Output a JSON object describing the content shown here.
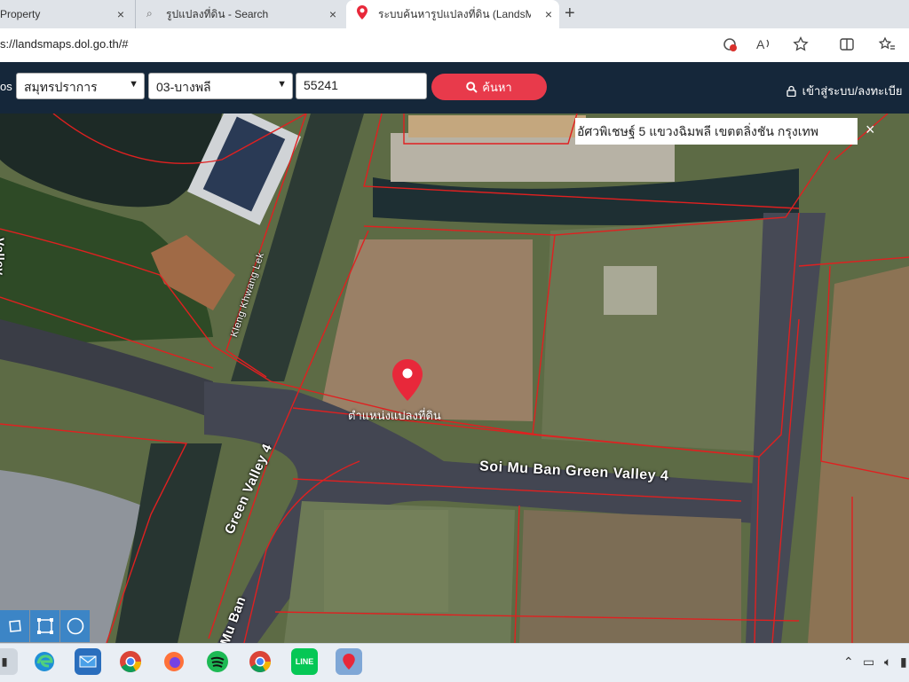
{
  "browser": {
    "tabs": [
      {
        "title": "Property",
        "close": "×"
      },
      {
        "title": "รูปแปลงที่ดิน - Search",
        "close": "×"
      },
      {
        "title": "ระบบค้นหารูปแปลงที่ดิน (LandsMaps",
        "close": "×"
      }
    ],
    "new_tab": "+",
    "url": "s://landsmaps.dol.go.th/#"
  },
  "header": {
    "lead_text": "os",
    "province": "สมุทรปราการ",
    "district": "03-บางพลี",
    "parcel_number": "55241",
    "search_label": "ค้นหา",
    "login_label": "เข้าสู่ระบบ/ลงทะเบีย"
  },
  "map": {
    "popup_text": "อัศวพิเชษฐ์ 5 แขวงฉิมพลี เขตตลิ่งชัน กรุงเทพ",
    "popup_close": "×",
    "pin_label": "ตำแหน่งแปลงที่ดิน",
    "road_labels": {
      "soi_green_valley_4_h": "Soi Mu Ban Green Valley 4",
      "green_valley_4_v": "Green Valley 4",
      "mu_ban_bottom": "Mu Ban",
      "khlong_label": "Kleng Khwang Lek",
      "valley_left": "Valley"
    },
    "parcel_line_color": "#e02020",
    "pin_color": "#e8283a"
  },
  "taskbar": {
    "apps": [
      "edge",
      "mail",
      "chrome",
      "firefox",
      "spotify",
      "chrome",
      "line",
      "app"
    ]
  }
}
